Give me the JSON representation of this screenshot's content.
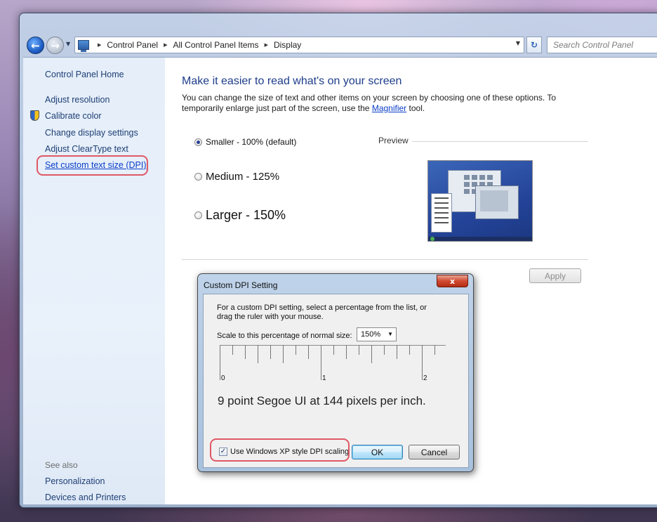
{
  "nav": {
    "crumbs": [
      "Control Panel",
      "All Control Panel Items",
      "Display"
    ],
    "search_placeholder": "Search Control Panel"
  },
  "sidebar": {
    "home": "Control Panel Home",
    "links": [
      "Adjust resolution",
      "Calibrate color",
      "Change display settings",
      "Adjust ClearType text",
      "Set custom text size (DPI)"
    ],
    "see_also_label": "See also",
    "see_also": [
      "Personalization",
      "Devices and Printers"
    ]
  },
  "main": {
    "title": "Make it easier to read what's on your screen",
    "description_part1": "You can change the size of text and other items on your screen by choosing one of these options. To temporarily enlarge just part of the screen, use the",
    "magnifier_link": "Magnifier",
    "description_part2": "tool.",
    "options": [
      {
        "label": "Smaller - 100% (default)",
        "selected": true
      },
      {
        "label": "Medium - 125%",
        "selected": false
      },
      {
        "label": "Larger - 150%",
        "selected": false
      }
    ],
    "preview_label": "Preview",
    "apply_label": "Apply"
  },
  "dialog": {
    "title": "Custom DPI Setting",
    "close_glyph": "x",
    "instructions": "For a custom DPI setting, select a percentage from the list, or drag the ruler with your mouse.",
    "scale_label": "Scale to this percentage of normal size:",
    "scale_value": "150%",
    "ruler_numbers": [
      "0",
      "1",
      "2"
    ],
    "dpi_info": "9 point Segoe UI at 144 pixels per inch.",
    "xp_checkbox_label": "Use Windows XP style DPI scaling",
    "xp_checked": true,
    "ok_label": "OK",
    "cancel_label": "Cancel"
  },
  "colors": {
    "link": "#1e3f75",
    "active_link": "#0a3ec9",
    "title_blue": "#1e3d8a",
    "highlight_ring": "#e05866"
  }
}
